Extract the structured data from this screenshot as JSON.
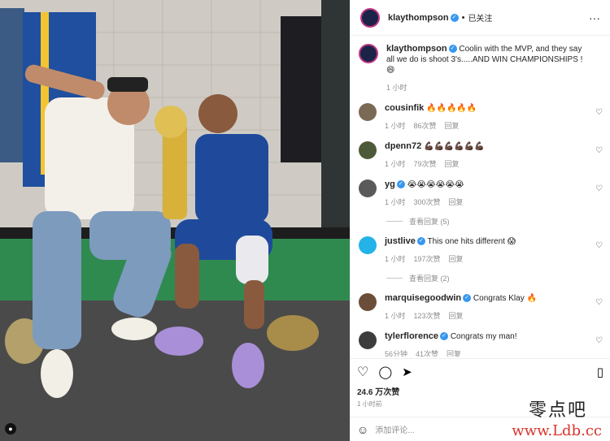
{
  "post": {
    "author": "klaythompson",
    "follow_label": "已关注",
    "caption": "Coolin with the MVP, and they say all we do is shoot 3's.....AND WIN CHAMPIONSHIPS !",
    "caption_emoji": "😄",
    "caption_time": "1 小时"
  },
  "comments": [
    {
      "user": "cousinfik",
      "verified": false,
      "text": "🔥🔥🔥🔥🔥",
      "time": "1 小时",
      "likes": "86次赞",
      "reply": "回复",
      "avatar_color": "#7a6a55"
    },
    {
      "user": "dpenn72",
      "verified": false,
      "text": "💪🏿💪🏿💪🏿💪🏿💪🏿💪🏿",
      "time": "1 小时",
      "likes": "79次赞",
      "reply": "回复",
      "avatar_color": "#4d5a3a"
    },
    {
      "user": "yg",
      "verified": true,
      "text": "😭😭😭😭😭😭",
      "time": "1 小时",
      "likes": "300次赞",
      "reply": "回复",
      "avatar_color": "#5a5a5a",
      "view_replies": "查看回复 (5)"
    },
    {
      "user": "justlive",
      "verified": true,
      "text": "This one hits different 😱",
      "time": "1 小时",
      "likes": "197次赞",
      "reply": "回复",
      "avatar_color": "#23b3e8",
      "view_replies": "查看回复 (2)"
    },
    {
      "user": "marquisegoodwin",
      "verified": true,
      "text": "Congrats Klay 🔥",
      "time": "1 小时",
      "likes": "123次赞",
      "reply": "回复",
      "avatar_color": "#6b4e3a"
    },
    {
      "user": "tylerflorence",
      "verified": true,
      "text": "Congrats my man!",
      "time": "56分钟",
      "likes": "41次赞",
      "reply": "回复",
      "avatar_color": "#3d3d3d"
    }
  ],
  "actions": {
    "likes": "24.6 万次赞",
    "time": "1 小时前",
    "add_comment_placeholder": "添加评论..."
  },
  "watermark": {
    "cn": "零点吧",
    "url": "www.Ldb.cc"
  },
  "colors": {
    "verified": "#3897f0",
    "ring": "#c13584"
  }
}
